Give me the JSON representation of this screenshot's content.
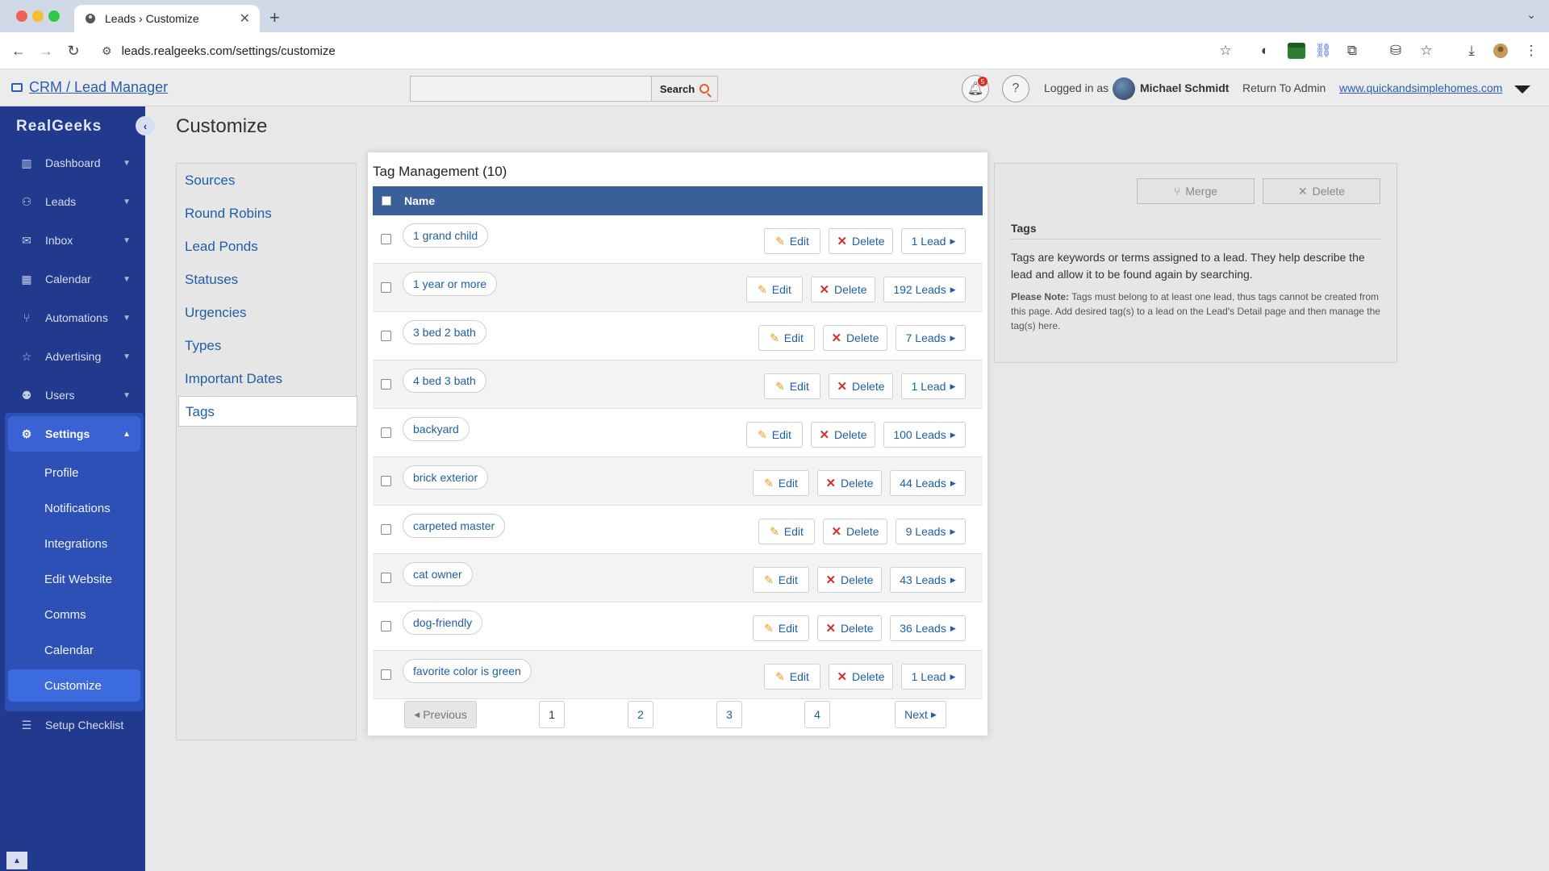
{
  "browser": {
    "tab_title": "Leads › Customize",
    "url": "leads.realgeeks.com/settings/customize",
    "ext_badge": "4pm"
  },
  "header": {
    "crm_title": "CRM / Lead Manager",
    "search_placeholder": "",
    "search_button": "Search",
    "notif_count": "5",
    "logged_in_label": "Logged in as",
    "user_name": "Michael Schmidt",
    "return_admin": "Return To Admin",
    "site_link": "www.quickandsimplehomes.com"
  },
  "sidebar": {
    "logo": "RealGeeks",
    "items": [
      {
        "label": "Dashboard",
        "icon": "chart-icon"
      },
      {
        "label": "Leads",
        "icon": "users-icon"
      },
      {
        "label": "Inbox",
        "icon": "mail-icon"
      },
      {
        "label": "Calendar",
        "icon": "calendar-icon"
      },
      {
        "label": "Automations",
        "icon": "automation-icon"
      },
      {
        "label": "Advertising",
        "icon": "star-icon"
      },
      {
        "label": "Users",
        "icon": "user-gear-icon"
      },
      {
        "label": "Settings",
        "icon": "gear-icon"
      }
    ],
    "settings_sub": [
      "Profile",
      "Notifications",
      "Integrations",
      "Edit Website",
      "Comms",
      "Calendar",
      "Customize"
    ],
    "setup_checklist": "Setup Checklist"
  },
  "main": {
    "title": "Customize",
    "nav": [
      "Sources",
      "Round Robins",
      "Lead Ponds",
      "Statuses",
      "Urgencies",
      "Types",
      "Important Dates",
      "Tags"
    ]
  },
  "tags": {
    "title": "Tag Management (10)",
    "column": "Name",
    "edit_label": "Edit",
    "delete_label": "Delete",
    "rows": [
      {
        "name": "1 grand child",
        "leads": "1 Lead"
      },
      {
        "name": "1 year or more",
        "leads": "192 Leads"
      },
      {
        "name": "3 bed 2 bath",
        "leads": "7 Leads"
      },
      {
        "name": "4 bed 3 bath",
        "leads": "1 Lead"
      },
      {
        "name": "backyard",
        "leads": "100 Leads"
      },
      {
        "name": "brick exterior",
        "leads": "44 Leads"
      },
      {
        "name": "carpeted master",
        "leads": "9 Leads"
      },
      {
        "name": "cat owner",
        "leads": "43 Leads"
      },
      {
        "name": "dog-friendly",
        "leads": "36 Leads"
      },
      {
        "name": "favorite color is green",
        "leads": "1 Lead"
      }
    ],
    "pagination": {
      "previous": "Previous",
      "pages": [
        "1",
        "2",
        "3",
        "4"
      ],
      "next": "Next",
      "current_page": 1
    }
  },
  "info": {
    "merge_button": "Merge",
    "delete_button": "Delete",
    "heading": "Tags",
    "description": "Tags are keywords or terms assigned to a lead. They help describe the lead and allow it to be found again by searching.",
    "note_label": "Please Note:",
    "note": "Tags must belong to at least one lead, thus tags cannot be created from this page. Add desired tag(s) to a lead on the Lead's Detail page and then manage the tag(s) here."
  },
  "colors": {
    "sidebar": "#223a8e",
    "settings_active": "#3962d3",
    "table_header": "#3b5f98",
    "link": "#1e5ea8",
    "edit_icon": "#e59a1d",
    "delete_icon": "#d32f2f"
  }
}
